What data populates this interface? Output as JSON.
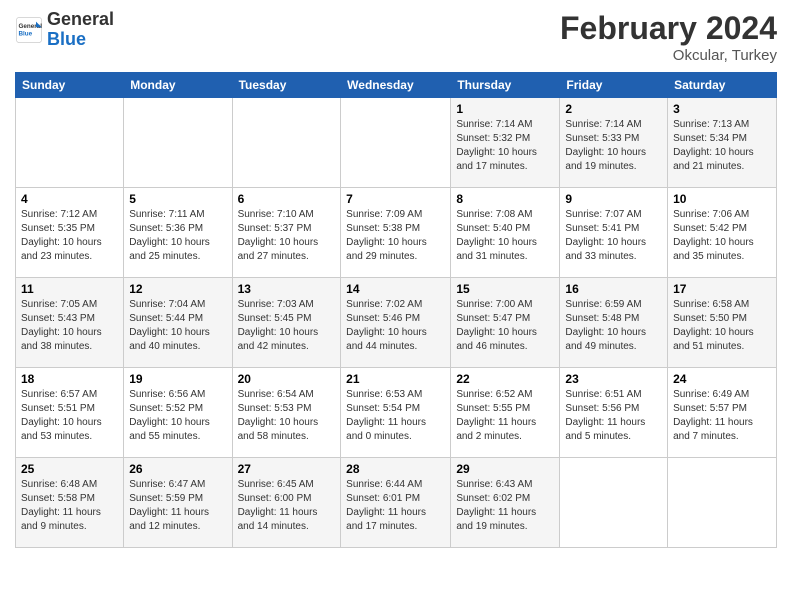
{
  "header": {
    "logo_general": "General",
    "logo_blue": "Blue",
    "month_year": "February 2024",
    "location": "Okcular, Turkey"
  },
  "days_of_week": [
    "Sunday",
    "Monday",
    "Tuesday",
    "Wednesday",
    "Thursday",
    "Friday",
    "Saturday"
  ],
  "weeks": [
    [
      {
        "num": "",
        "info": ""
      },
      {
        "num": "",
        "info": ""
      },
      {
        "num": "",
        "info": ""
      },
      {
        "num": "",
        "info": ""
      },
      {
        "num": "1",
        "info": "Sunrise: 7:14 AM\nSunset: 5:32 PM\nDaylight: 10 hours\nand 17 minutes."
      },
      {
        "num": "2",
        "info": "Sunrise: 7:14 AM\nSunset: 5:33 PM\nDaylight: 10 hours\nand 19 minutes."
      },
      {
        "num": "3",
        "info": "Sunrise: 7:13 AM\nSunset: 5:34 PM\nDaylight: 10 hours\nand 21 minutes."
      }
    ],
    [
      {
        "num": "4",
        "info": "Sunrise: 7:12 AM\nSunset: 5:35 PM\nDaylight: 10 hours\nand 23 minutes."
      },
      {
        "num": "5",
        "info": "Sunrise: 7:11 AM\nSunset: 5:36 PM\nDaylight: 10 hours\nand 25 minutes."
      },
      {
        "num": "6",
        "info": "Sunrise: 7:10 AM\nSunset: 5:37 PM\nDaylight: 10 hours\nand 27 minutes."
      },
      {
        "num": "7",
        "info": "Sunrise: 7:09 AM\nSunset: 5:38 PM\nDaylight: 10 hours\nand 29 minutes."
      },
      {
        "num": "8",
        "info": "Sunrise: 7:08 AM\nSunset: 5:40 PM\nDaylight: 10 hours\nand 31 minutes."
      },
      {
        "num": "9",
        "info": "Sunrise: 7:07 AM\nSunset: 5:41 PM\nDaylight: 10 hours\nand 33 minutes."
      },
      {
        "num": "10",
        "info": "Sunrise: 7:06 AM\nSunset: 5:42 PM\nDaylight: 10 hours\nand 35 minutes."
      }
    ],
    [
      {
        "num": "11",
        "info": "Sunrise: 7:05 AM\nSunset: 5:43 PM\nDaylight: 10 hours\nand 38 minutes."
      },
      {
        "num": "12",
        "info": "Sunrise: 7:04 AM\nSunset: 5:44 PM\nDaylight: 10 hours\nand 40 minutes."
      },
      {
        "num": "13",
        "info": "Sunrise: 7:03 AM\nSunset: 5:45 PM\nDaylight: 10 hours\nand 42 minutes."
      },
      {
        "num": "14",
        "info": "Sunrise: 7:02 AM\nSunset: 5:46 PM\nDaylight: 10 hours\nand 44 minutes."
      },
      {
        "num": "15",
        "info": "Sunrise: 7:00 AM\nSunset: 5:47 PM\nDaylight: 10 hours\nand 46 minutes."
      },
      {
        "num": "16",
        "info": "Sunrise: 6:59 AM\nSunset: 5:48 PM\nDaylight: 10 hours\nand 49 minutes."
      },
      {
        "num": "17",
        "info": "Sunrise: 6:58 AM\nSunset: 5:50 PM\nDaylight: 10 hours\nand 51 minutes."
      }
    ],
    [
      {
        "num": "18",
        "info": "Sunrise: 6:57 AM\nSunset: 5:51 PM\nDaylight: 10 hours\nand 53 minutes."
      },
      {
        "num": "19",
        "info": "Sunrise: 6:56 AM\nSunset: 5:52 PM\nDaylight: 10 hours\nand 55 minutes."
      },
      {
        "num": "20",
        "info": "Sunrise: 6:54 AM\nSunset: 5:53 PM\nDaylight: 10 hours\nand 58 minutes."
      },
      {
        "num": "21",
        "info": "Sunrise: 6:53 AM\nSunset: 5:54 PM\nDaylight: 11 hours\nand 0 minutes."
      },
      {
        "num": "22",
        "info": "Sunrise: 6:52 AM\nSunset: 5:55 PM\nDaylight: 11 hours\nand 2 minutes."
      },
      {
        "num": "23",
        "info": "Sunrise: 6:51 AM\nSunset: 5:56 PM\nDaylight: 11 hours\nand 5 minutes."
      },
      {
        "num": "24",
        "info": "Sunrise: 6:49 AM\nSunset: 5:57 PM\nDaylight: 11 hours\nand 7 minutes."
      }
    ],
    [
      {
        "num": "25",
        "info": "Sunrise: 6:48 AM\nSunset: 5:58 PM\nDaylight: 11 hours\nand 9 minutes."
      },
      {
        "num": "26",
        "info": "Sunrise: 6:47 AM\nSunset: 5:59 PM\nDaylight: 11 hours\nand 12 minutes."
      },
      {
        "num": "27",
        "info": "Sunrise: 6:45 AM\nSunset: 6:00 PM\nDaylight: 11 hours\nand 14 minutes."
      },
      {
        "num": "28",
        "info": "Sunrise: 6:44 AM\nSunset: 6:01 PM\nDaylight: 11 hours\nand 17 minutes."
      },
      {
        "num": "29",
        "info": "Sunrise: 6:43 AM\nSunset: 6:02 PM\nDaylight: 11 hours\nand 19 minutes."
      },
      {
        "num": "",
        "info": ""
      },
      {
        "num": "",
        "info": ""
      }
    ]
  ]
}
